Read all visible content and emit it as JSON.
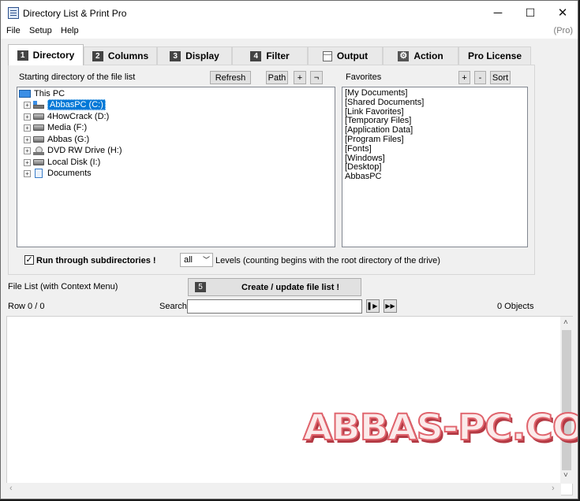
{
  "window": {
    "title": "Directory List & Print Pro",
    "minimize": "─",
    "maximize": "☐",
    "close": "✕"
  },
  "menu": {
    "items": [
      "File",
      "Setup",
      "Help"
    ],
    "edition": "(Pro)"
  },
  "tabs": [
    {
      "num": "1",
      "label": "Directory",
      "active": true
    },
    {
      "num": "2",
      "label": "Columns"
    },
    {
      "num": "3",
      "label": "Display"
    },
    {
      "num": "4",
      "label": "Filter"
    },
    {
      "num": "",
      "label": "Output",
      "icon": "output-icon"
    },
    {
      "num": "",
      "label": "Action",
      "icon": "gear-icon"
    },
    {
      "num": "",
      "label": "Pro License"
    }
  ],
  "directory": {
    "start_label": "Starting directory of the file list",
    "refresh": "Refresh",
    "path": "Path",
    "plus": "+",
    "not": "¬",
    "tree_root": "This PC",
    "tree_items": [
      {
        "label": "AbbasPC (C:)",
        "icon": "system-drive-icon",
        "selected": true
      },
      {
        "label": "4HowCrack (D:)",
        "icon": "drive-icon"
      },
      {
        "label": "Media (F:)",
        "icon": "drive-icon"
      },
      {
        "label": "Abbas (G:)",
        "icon": "drive-icon"
      },
      {
        "label": "DVD RW Drive (H:)",
        "icon": "dvd-drive-icon"
      },
      {
        "label": "Local Disk (I:)",
        "icon": "drive-icon"
      },
      {
        "label": "Documents",
        "icon": "documents-icon"
      }
    ],
    "run_sub": "Run through subdirectories !",
    "run_sub_checked": true,
    "levels_value": "all",
    "levels_text": "Levels  (counting begins with the root directory of the drive)"
  },
  "favorites": {
    "label": "Favorites",
    "add": "+",
    "remove": "-",
    "sort": "Sort",
    "items": [
      "[My Documents]",
      "[Shared Documents]",
      "[Link Favorites]",
      "[Temporary Files]",
      "[Application Data]",
      "[Program Files]",
      "[Fonts]",
      "[Windows]",
      "[Desktop]",
      "AbbasPC"
    ]
  },
  "filelist": {
    "label": "File List (with Context Menu)",
    "create_num": "5",
    "create_label": "Create / update file list !",
    "row": "Row 0 / 0",
    "search_label": "Search",
    "search_value": "",
    "objects": "0 Objects"
  },
  "watermark": "ABBAS-PC.COM"
}
